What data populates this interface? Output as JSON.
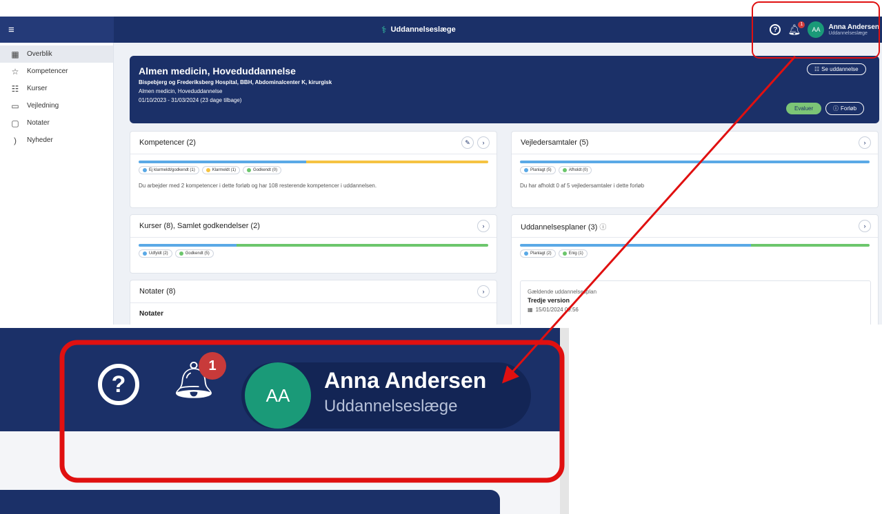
{
  "topbar": {
    "menu_icon": "hamburger-icon",
    "app_title": "Uddannelseslæge",
    "logo_icon": "caduceus-icon",
    "help_icon": "question-icon",
    "bell_icon": "bell-icon",
    "notification_count": "1",
    "user": {
      "initials": "AA",
      "name": "Anna Andersen",
      "role": "Uddannelseslæge"
    }
  },
  "sidebar": {
    "items": [
      {
        "label": "Overblik",
        "icon": "calendar-icon",
        "active": true
      },
      {
        "label": "Kompetencer",
        "icon": "star-icon"
      },
      {
        "label": "Kurser",
        "icon": "grid-list-icon"
      },
      {
        "label": "Vejledning",
        "icon": "chat-icon"
      },
      {
        "label": "Notater",
        "icon": "note-icon"
      },
      {
        "label": "Nyheder",
        "icon": "rss-icon"
      }
    ]
  },
  "hero": {
    "title": "Almen medicin, Hoveduddannelse",
    "place": "Bispebjerg og Frederiksberg Hospital, BBH, Abdominalcenter K, kirurgisk",
    "subtitle": "Almen medicin, Hoveduddannelse",
    "period": "01/10/2023 - 31/03/2024  (23 dage tilbage)",
    "see_button": "Se uddannelse",
    "evaluate_button": "Evaluer",
    "course_button": "Forløb"
  },
  "cards": {
    "kompetencer": {
      "title": "Kompetencer (2)",
      "chips": [
        "Ej klarmeldt/godkendt (1)",
        "Klarmeldt (1)",
        "Godkendt (0)"
      ],
      "desc": "Du arbejder med 2 kompetencer i dette forløb og har 108 resterende kompetencer i uddannelsen."
    },
    "vejledersamtaler": {
      "title": "Vejledersamtaler (5)",
      "chips": [
        "Planlagt (5)",
        "Afholdt (0)"
      ],
      "desc": "Du har afholdt 0 af 5 vejledersamtaler i dette forløb"
    },
    "kurser": {
      "title": "Kurser (8), Samlet godkendelser (2)",
      "chips": [
        "Udfyldt (2)",
        "Godkendt (5)"
      ]
    },
    "uddannelsesplaner": {
      "title": "Uddannelsesplaner (3)",
      "chips": [
        "Planlagt (2)",
        "Enig (1)"
      ],
      "plan_label": "Gældende uddannelsesplan",
      "plan_version": "Tredje version",
      "plan_date": "15/01/2024  09:56"
    },
    "notater": {
      "title": "Notater (8)",
      "subtitle": "Notater"
    }
  },
  "colors": {
    "navy": "#1b3068",
    "blue": "#5aa9e6",
    "yellow": "#f5c342",
    "green": "#6cc66c",
    "annotation_red": "#e01010"
  }
}
